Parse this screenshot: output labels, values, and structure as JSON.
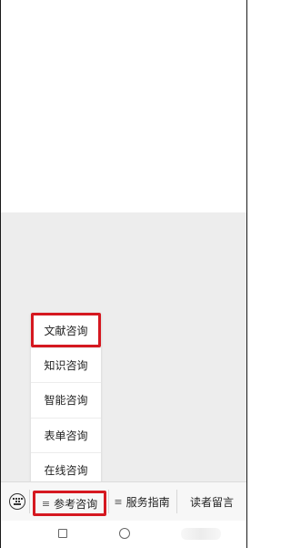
{
  "submenu": {
    "items": [
      {
        "label": "文献咨询"
      },
      {
        "label": "知识咨询"
      },
      {
        "label": "智能咨询"
      },
      {
        "label": "表单咨询"
      },
      {
        "label": "在线咨询"
      }
    ],
    "selected": "文献咨询"
  },
  "bottom_menu": {
    "keyboard_icon": "keyboard-icon",
    "items": [
      {
        "label": "参考咨询",
        "icon": "≡"
      },
      {
        "label": "服务指南",
        "icon": "≡"
      },
      {
        "label": "读者留言"
      }
    ],
    "selected": "参考咨询"
  },
  "highlight_color": "#d51820"
}
